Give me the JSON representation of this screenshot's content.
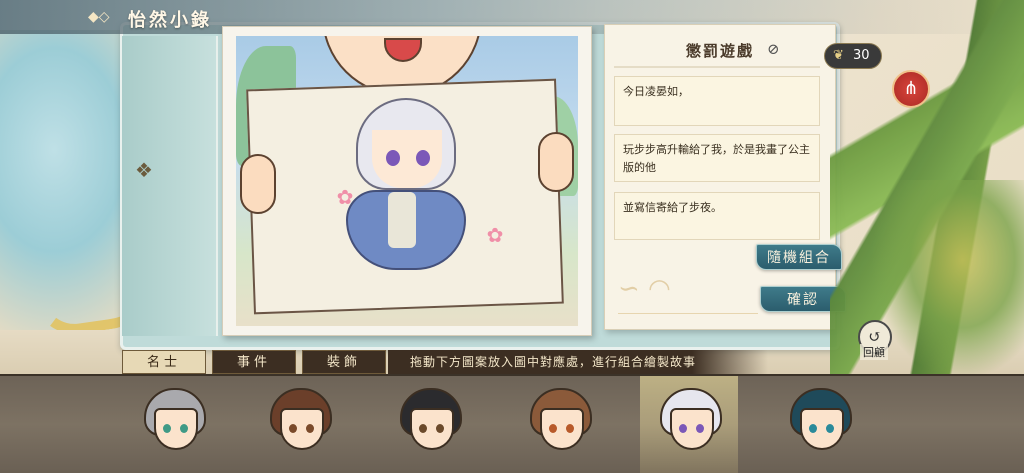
{
  "header": {
    "title": "怡然小錄",
    "ornament_icon": "cloud-ornament-icon"
  },
  "notebook": {
    "title": "懲罰遊戲",
    "title_icon": "no-entry-icon",
    "entries": [
      "今日凌晏如，",
      "玩步步高升輸給了我，於是我畫了公主版的他",
      "並寫信寄給了步夜。"
    ],
    "random_button": "隨機組合",
    "confirm_button": "確認"
  },
  "currency": {
    "icon": "feather-icon",
    "value": "30"
  },
  "share": {
    "icon": "share-icon"
  },
  "review": {
    "label": "回顧",
    "icon": "review-icon"
  },
  "tabs": [
    {
      "label": "名士",
      "active": true
    },
    {
      "label": "事件",
      "active": false
    },
    {
      "label": "裝飾",
      "active": false
    }
  ],
  "hint": "拖動下方圖案放入圖中對應處，進行組合繪製故事",
  "characters": [
    {
      "id": "char-1",
      "hair": "#a9a9ad",
      "eye": "#3f9a86",
      "selected": false
    },
    {
      "id": "char-2",
      "hair": "#6b3f2a",
      "eye": "#7a4a2a",
      "selected": false
    },
    {
      "id": "char-3",
      "hair": "#2b2b2e",
      "eye": "#6b4a2b",
      "selected": false
    },
    {
      "id": "char-4",
      "hair": "#8b5a3a",
      "eye": "#b85a2a",
      "selected": false
    },
    {
      "id": "char-5",
      "hair": "#e6e6ee",
      "eye": "#7b58b8",
      "selected": true
    },
    {
      "id": "char-6",
      "hair": "#1f4a5a",
      "eye": "#2a8a9a",
      "selected": false
    }
  ],
  "colors": {
    "accent_teal": "#2b5d6d",
    "tab_dark": "#3c2e22",
    "tab_light": "#e7d9b6",
    "share_red": "#c0362f"
  }
}
